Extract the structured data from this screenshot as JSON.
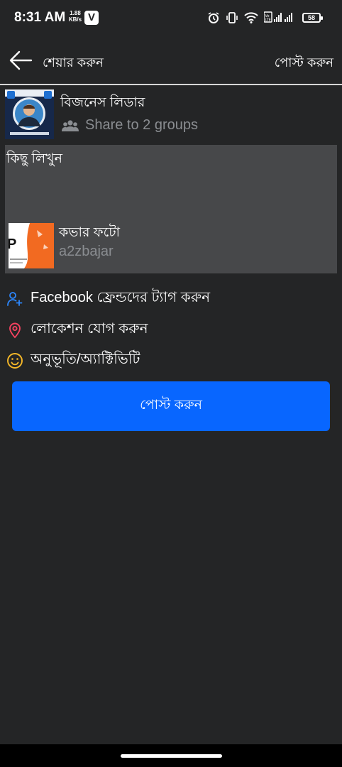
{
  "status_bar": {
    "time": "8:31 AM",
    "net_speed": "1.88 KB/s",
    "app_badge": "V",
    "battery": "58"
  },
  "appbar": {
    "title": "শেয়ার করুন",
    "post_label": "পোস্ট করুন"
  },
  "page": {
    "name": "বিজনেস লিডার",
    "share_text": "Share to 2 groups"
  },
  "compose": {
    "placeholder": "কিছু লিখুন",
    "link_title": "কভার ফটো",
    "link_domain": "a2zbajar"
  },
  "options": [
    {
      "label": "Facebook ফ্রেন্ডদের ট্যাগ করুন",
      "icon": "tag-friends-icon",
      "color": "#2d88ff"
    },
    {
      "label": "লোকেশন যোগ করুন",
      "icon": "location-pin-icon",
      "color": "#f3425f"
    },
    {
      "label": "অনুভূতি/অ্যাক্টিভিটি",
      "icon": "smiley-icon",
      "color": "#f7b928"
    }
  ],
  "post_button": {
    "label": "পোস্ট করুন",
    "color": "#0866ff"
  },
  "colors": {
    "background": "#242526",
    "compose_bg": "#47484a",
    "secondary_text": "#8a8d91"
  }
}
